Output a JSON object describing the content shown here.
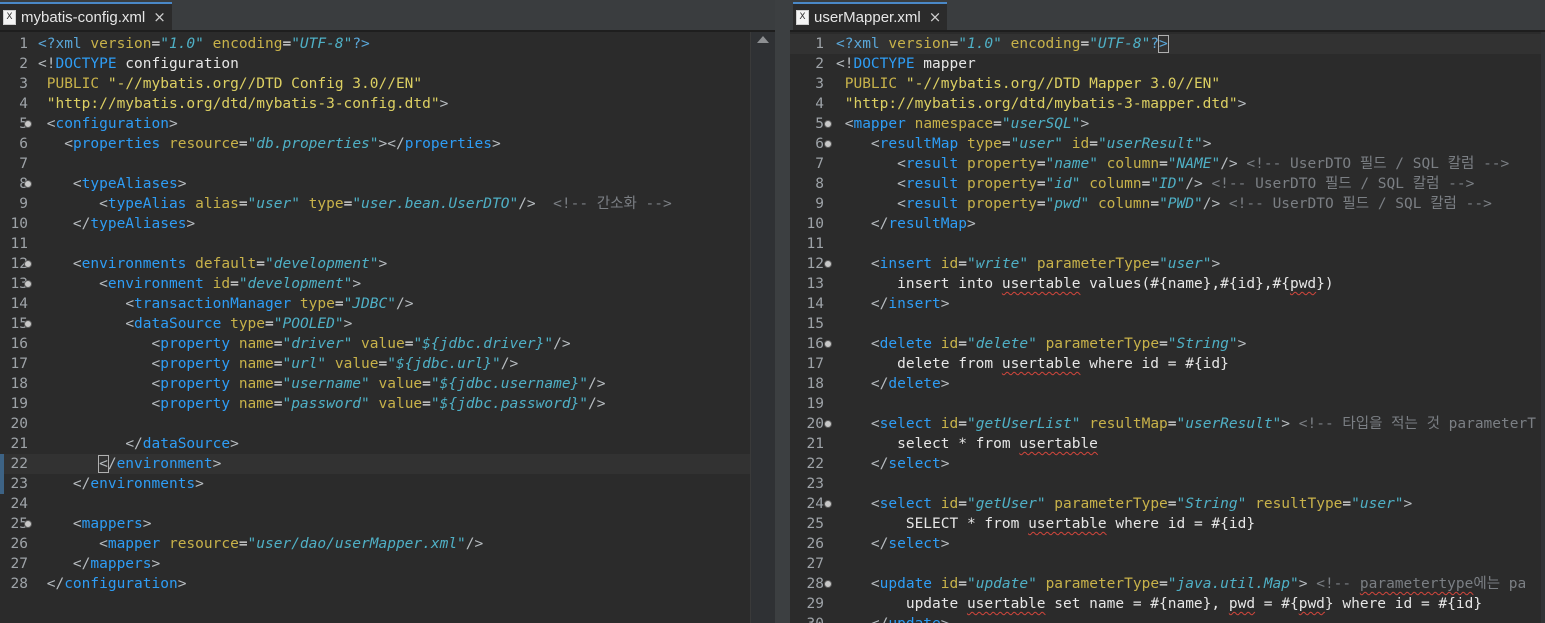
{
  "left": {
    "tab": {
      "icon": "xml-file-icon",
      "title": "mybatis-config.xml",
      "close": "×"
    },
    "line_numbers": [
      "1",
      "2",
      "3",
      "4",
      "5",
      "6",
      "7",
      "8",
      "9",
      "10",
      "11",
      "12",
      "13",
      "14",
      "15",
      "16",
      "17",
      "18",
      "19",
      "20",
      "21",
      "22",
      "23",
      "24",
      "25",
      "26",
      "27",
      "28"
    ]
  },
  "right": {
    "tab": {
      "icon": "xml-file-icon",
      "title": "userMapper.xml",
      "close": "×"
    },
    "line_numbers": [
      "1",
      "2",
      "3",
      "4",
      "5",
      "6",
      "7",
      "8",
      "9",
      "10",
      "11",
      "12",
      "13",
      "14",
      "15",
      "16",
      "17",
      "18",
      "19",
      "20",
      "21",
      "22",
      "23",
      "24",
      "25",
      "26",
      "27",
      "28",
      "29",
      "30"
    ]
  },
  "colors": {
    "keyword": "#2e9df5",
    "attribute": "#c8b24a",
    "string": "#4fb0c6",
    "comment": "#7b7f84",
    "text": "#e6e6e6",
    "background": "#2b2b2b"
  }
}
